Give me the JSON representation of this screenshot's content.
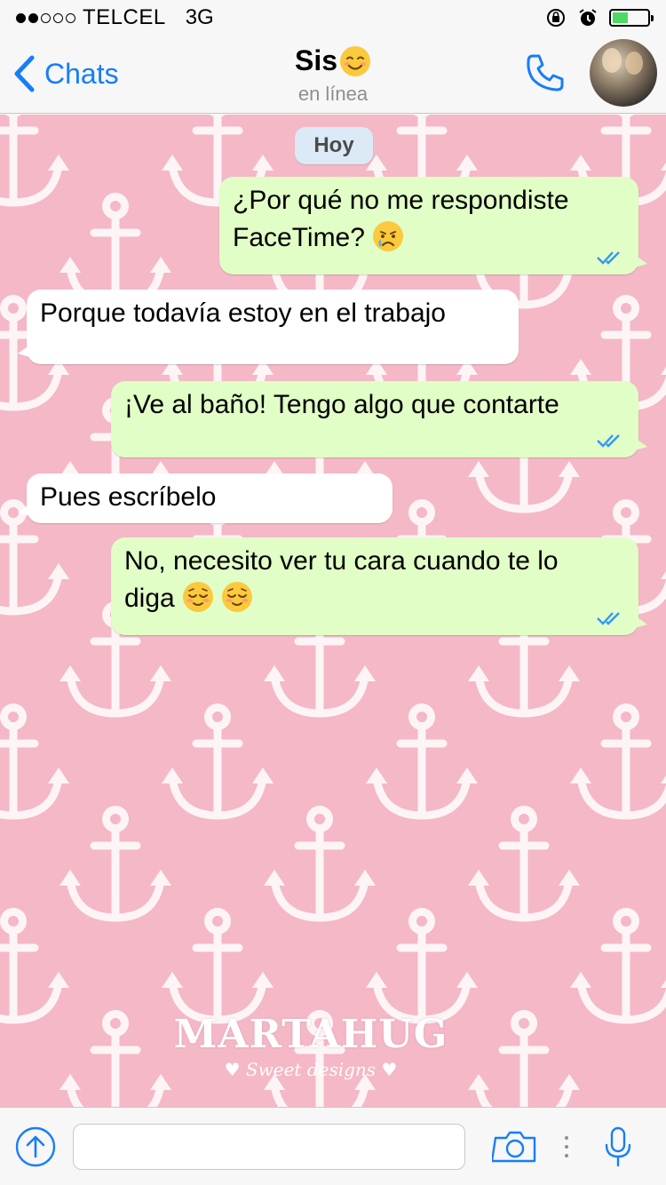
{
  "status_bar": {
    "carrier": "TELCEL",
    "network": "3G",
    "signal_bars_filled": 2,
    "signal_bars_total": 5,
    "battery_level": 0.45,
    "battery_color": "#4cd964"
  },
  "header": {
    "back_label": "Chats",
    "contact_name": "Sis",
    "contact_emoji": "smiling-face-icon",
    "status": "en línea"
  },
  "chat": {
    "background_color": "#f4b8c6",
    "date_label": "Hoy",
    "messages": [
      {
        "direction": "outgoing",
        "line1": "¿Por qué no me respondiste",
        "line2": "FaceTime?",
        "emoji": "crying-face-icon",
        "read_ticks": true
      },
      {
        "direction": "incoming",
        "text": "Porque todavía estoy en el trabajo"
      },
      {
        "direction": "outgoing",
        "text": "¡Ve al baño! Tengo algo que contarte",
        "read_ticks": true
      },
      {
        "direction": "incoming",
        "text": "Pues escríbelo"
      },
      {
        "direction": "outgoing",
        "line1": "No, necesito ver tu cara cuando te lo",
        "line2": "diga",
        "emoji": "relieved-face-icon",
        "emoji_count": 2,
        "read_ticks": true
      }
    ],
    "watermark": {
      "title": "MARTAHUG",
      "subtitle": "♥ Sweet designs ♥"
    }
  },
  "input_bar": {
    "message_value": "",
    "accent_color": "#157efb"
  }
}
